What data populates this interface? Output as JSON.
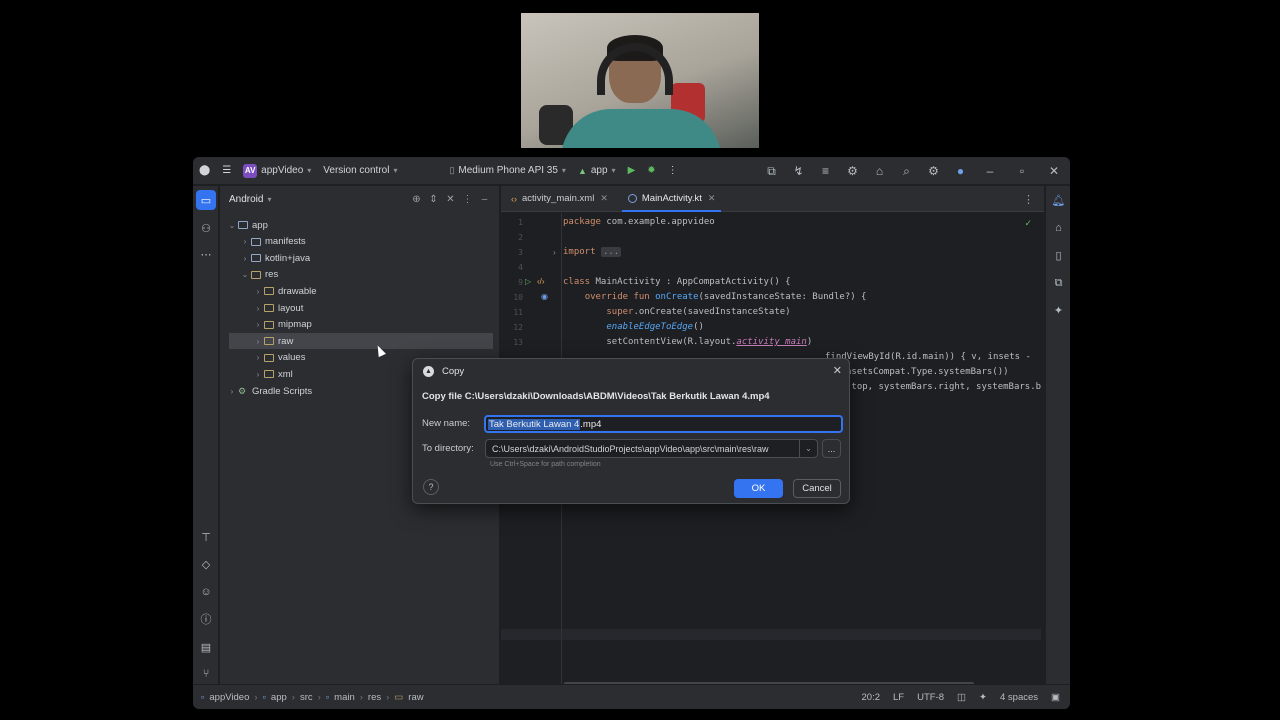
{
  "titlebar": {
    "project_badge": "AV",
    "project_name": "appVideo",
    "vcs": "Version control",
    "device": "Medium Phone API 35",
    "run_config": "app"
  },
  "project_panel": {
    "view": "Android",
    "tree": [
      {
        "label": "app",
        "depth": 0,
        "expanded": true,
        "kind": "module"
      },
      {
        "label": "manifests",
        "depth": 1,
        "expanded": false,
        "kind": "folder"
      },
      {
        "label": "kotlin+java",
        "depth": 1,
        "expanded": false,
        "kind": "folder"
      },
      {
        "label": "res",
        "depth": 1,
        "expanded": true,
        "kind": "res"
      },
      {
        "label": "drawable",
        "depth": 2,
        "expanded": false,
        "kind": "res"
      },
      {
        "label": "layout",
        "depth": 2,
        "expanded": false,
        "kind": "res"
      },
      {
        "label": "mipmap",
        "depth": 2,
        "expanded": false,
        "kind": "res"
      },
      {
        "label": "raw",
        "depth": 2,
        "expanded": false,
        "kind": "res",
        "selected": true
      },
      {
        "label": "values",
        "depth": 2,
        "expanded": false,
        "kind": "res"
      },
      {
        "label": "xml",
        "depth": 2,
        "expanded": false,
        "kind": "res"
      },
      {
        "label": "Gradle Scripts",
        "depth": 0,
        "expanded": false,
        "kind": "gradle"
      }
    ]
  },
  "editor": {
    "tabs": [
      {
        "label": "activity_main.xml",
        "active": false
      },
      {
        "label": "MainActivity.kt",
        "active": true
      }
    ],
    "line_numbers": [
      "1",
      "2",
      "3",
      "4",
      "9",
      "10",
      "11",
      "12",
      "13"
    ],
    "code": {
      "line1_kw": "package",
      "line1_rest": " com.example.appvideo",
      "line3_kw": "import",
      "line3_fold": "...",
      "line9_kw": "class",
      "line9_rest": " MainActivity : AppCompatActivity() {",
      "line10_kw": "override fun",
      "line10_fn": "onCreate",
      "line10_rest": "(savedInstanceState: Bundle?) {",
      "line11_kw": "super",
      "line11_rest": ".onCreate(savedInstanceState)",
      "line12_it": "enableEdgeToEdge",
      "line12_rest": "()",
      "line13_a": "setContentView(R.layout.",
      "line13_pr": "activity_main",
      "line13_b": ")",
      "line14_visible": "findViewById(R.id.main)) { v, insets -",
      "line15_visible": "nsetsCompat.Type.systemBars())",
      "line16_visible": ".top, systemBars.right, systemBars.b"
    }
  },
  "dialog": {
    "title": "Copy",
    "heading": "Copy file C:\\Users\\dzaki\\Downloads\\ABDM\\Videos\\Tak Berkutik Lawan  4.mp4",
    "new_name_label": "New name:",
    "new_name_selected": "Tak Berkutik Lawan  4",
    "new_name_rest": ".mp4",
    "to_dir_label": "To directory:",
    "to_dir_value": "C:\\Users\\dzaki\\AndroidStudioProjects\\appVideo\\app\\src\\main\\res\\raw",
    "hint": "Use Ctrl+Space for path completion",
    "browse": "...",
    "help": "?",
    "ok": "OK",
    "cancel": "Cancel"
  },
  "statusbar": {
    "breadcrumbs": [
      "appVideo",
      "app",
      "src",
      "main",
      "res",
      "raw"
    ],
    "position": "20:2",
    "line_sep": "LF",
    "encoding": "UTF-8",
    "indent": "4 spaces"
  },
  "colors": {
    "accent": "#3574f0",
    "panel_bg": "#2b2d30",
    "editor_bg": "#1e1f22",
    "keyword": "#cf8e6d",
    "function": "#56a8f5"
  }
}
